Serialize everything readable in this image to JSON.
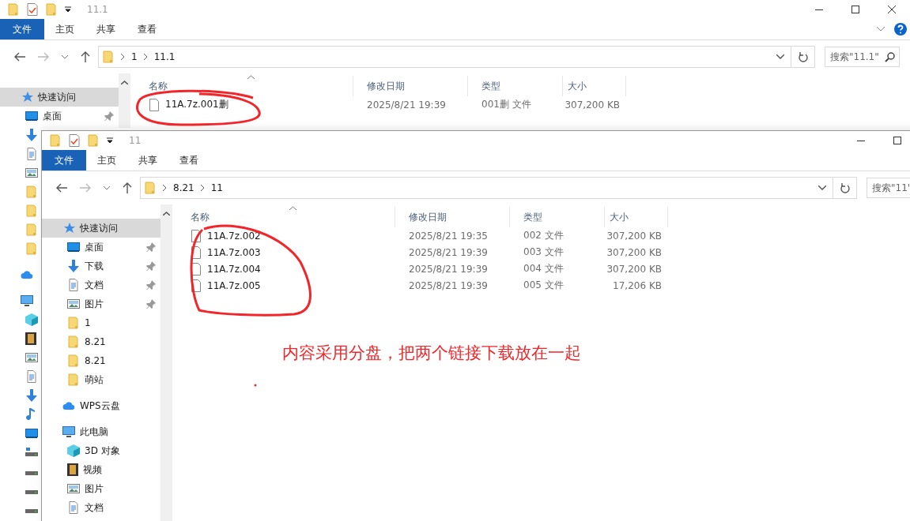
{
  "windows": [
    {
      "title": "11.1",
      "controls": [
        {
          "kind": "minimize"
        },
        {
          "kind": "maximize"
        },
        {
          "kind": "close"
        }
      ],
      "help_button": true,
      "ribbon_tabs": [
        {
          "label": "文件",
          "kind": "file"
        },
        {
          "label": "主页",
          "kind": "tab"
        },
        {
          "label": "共享",
          "kind": "tab"
        },
        {
          "label": "查看",
          "kind": "tab"
        }
      ],
      "address": {
        "path": [
          "1",
          "11.1"
        ]
      },
      "search": {
        "placeholder": "搜索\"11.1\""
      },
      "sidebar": {
        "items": [
          {
            "kind": "quick",
            "label": "快速访问",
            "selected": true,
            "children": [
              {
                "kind": "desktop",
                "label": "桌面",
                "pinned": true,
                "selected": false
              },
              {
                "kind": "download",
                "selected": false
              },
              {
                "kind": "doc",
                "selected": false
              },
              {
                "kind": "picture",
                "selected": false
              },
              {
                "kind": "folder",
                "selected": false
              },
              {
                "kind": "folder",
                "selected": false
              },
              {
                "kind": "folder",
                "selected": false
              },
              {
                "kind": "folder",
                "selected": false
              }
            ]
          },
          {
            "kind": "cloud",
            "selected": false
          },
          {
            "kind": "pc",
            "selected": false,
            "children": [
              {
                "kind": "cube",
                "selected": false
              },
              {
                "kind": "film",
                "selected": false
              },
              {
                "kind": "picture",
                "selected": false
              },
              {
                "kind": "doc",
                "selected": false
              },
              {
                "kind": "download",
                "selected": false
              },
              {
                "kind": "music",
                "selected": false
              },
              {
                "kind": "desktop",
                "selected": false
              },
              {
                "kind": "drive-win",
                "selected": false
              },
              {
                "kind": "drive",
                "selected": false
              },
              {
                "kind": "drive",
                "selected": false
              },
              {
                "kind": "drive",
                "selected": false
              }
            ]
          }
        ]
      },
      "table": {
        "columns": [
          "名称",
          "修改日期",
          "类型",
          "大小"
        ],
        "rows": [
          {
            "name": "11A.7z.001删",
            "date": "2025/8/21 19:39",
            "type": "001删 文件",
            "size": "307,200 KB"
          }
        ]
      }
    },
    {
      "title": "11",
      "controls": [
        {
          "kind": "minimize"
        },
        {
          "kind": "maximize"
        }
      ],
      "help_button": false,
      "ribbon_tabs": [
        {
          "label": "文件",
          "kind": "file"
        },
        {
          "label": "主页",
          "kind": "tab"
        },
        {
          "label": "共享",
          "kind": "tab"
        },
        {
          "label": "查看",
          "kind": "tab"
        }
      ],
      "address": {
        "path": [
          "8.21",
          "11"
        ]
      },
      "search": {
        "placeholder": "搜索\"11\""
      },
      "sidebar": {
        "items": [
          {
            "kind": "quick",
            "label": "快速访问",
            "selected": true,
            "children": [
              {
                "kind": "desktop",
                "label": "桌面",
                "pinned": true,
                "selected": false
              },
              {
                "kind": "download",
                "label": "下载",
                "pinned": true,
                "selected": false
              },
              {
                "kind": "doc",
                "label": "文档",
                "pinned": true,
                "selected": false
              },
              {
                "kind": "picture",
                "label": "图片",
                "pinned": true,
                "selected": false
              },
              {
                "kind": "folder",
                "label": "1",
                "pinned": false,
                "selected": false
              },
              {
                "kind": "folder",
                "label": "8.21",
                "pinned": false,
                "selected": false
              },
              {
                "kind": "folder",
                "label": "8.21",
                "pinned": false,
                "selected": false
              },
              {
                "kind": "folder",
                "label": "萌站",
                "pinned": false,
                "selected": false
              }
            ]
          },
          {
            "kind": "cloud",
            "label": "WPS云盘",
            "selected": false
          },
          {
            "kind": "pc",
            "label": "此电脑",
            "selected": false,
            "children": [
              {
                "kind": "cube",
                "label": "3D 对象",
                "selected": false
              },
              {
                "kind": "film",
                "label": "视频",
                "selected": false
              },
              {
                "kind": "picture",
                "label": "图片",
                "selected": false
              },
              {
                "kind": "doc",
                "label": "文档",
                "selected": false
              }
            ]
          }
        ]
      },
      "table": {
        "columns": [
          "名称",
          "修改日期",
          "类型",
          "大小"
        ],
        "rows": [
          {
            "name": "11A.7z.002",
            "date": "2025/8/21 19:35",
            "type": "002 文件",
            "size": "307,200 KB"
          },
          {
            "name": "11A.7z.003",
            "date": "2025/8/21 19:39",
            "type": "003 文件",
            "size": "307,200 KB"
          },
          {
            "name": "11A.7z.004",
            "date": "2025/8/21 19:39",
            "type": "004 文件",
            "size": "307,200 KB"
          },
          {
            "name": "11A.7z.005",
            "date": "2025/8/21 19:39",
            "type": "005 文件",
            "size": "17,206 KB"
          }
        ]
      }
    }
  ],
  "annotation": {
    "text": "内容采用分盘，把两个链接下载放在一起"
  }
}
